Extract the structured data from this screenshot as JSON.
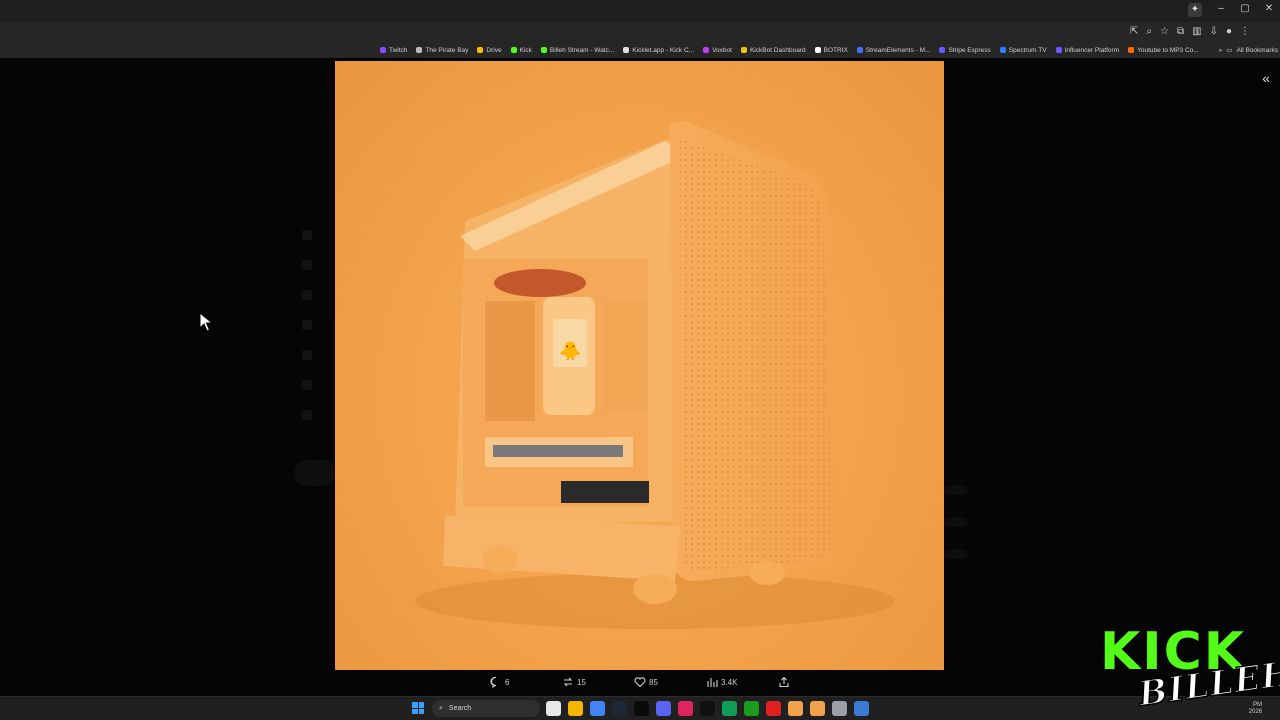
{
  "window": {
    "controls": [
      "–",
      "▢",
      "✕"
    ]
  },
  "bookmarks": [
    {
      "label": "Twitch",
      "color": "#9146ff"
    },
    {
      "label": "The Pirate Bay",
      "color": "#bbbbbb"
    },
    {
      "label": "Drive",
      "color": "#fbbc04"
    },
    {
      "label": "Kick",
      "color": "#53fc18"
    },
    {
      "label": "Billeh Stream - Watc...",
      "color": "#53fc18"
    },
    {
      "label": "Kicklet.app - Kick C...",
      "color": "#dddddd"
    },
    {
      "label": "Voxbot",
      "color": "#c13bff"
    },
    {
      "label": "KickBot Dashboard",
      "color": "#f4c20d"
    },
    {
      "label": "BOTRIX",
      "color": "#ffffff"
    },
    {
      "label": "StreamElements - M...",
      "color": "#4a6cf7"
    },
    {
      "label": "Stripe Express",
      "color": "#635bff"
    },
    {
      "label": "Spectrum TV",
      "color": "#2a7fff"
    },
    {
      "label": "Influencer Platform",
      "color": "#6b5bff"
    },
    {
      "label": "Youtube to MP3 Co...",
      "color": "#ff6a00"
    }
  ],
  "bookmarks_more": "»",
  "all_bookmarks": "All Bookmarks",
  "post": {
    "actions": {
      "replies": "6",
      "reposts": "15",
      "likes": "85",
      "views": "3.4K"
    }
  },
  "overlay": {
    "kick_word": "KICK",
    "kick_sub": "BILLEH",
    "clock_time": "PM",
    "clock_date": "2026"
  },
  "taskbar": {
    "search_placeholder": "Search",
    "apps": [
      "#e8e8e8",
      "#f4b400",
      "#4285f4",
      "#1b2838",
      "#0a0a0a",
      "#5865f2",
      "#e0245e",
      "#111111",
      "#0f9d58",
      "#1d9b1d",
      "#e02020",
      "#f2a24a",
      "#f2a24a",
      "#9aa0a6",
      "#3a7bd5"
    ]
  },
  "colors": {
    "media_bg": "#f2a24a",
    "case": "#f7b061",
    "accent_green": "#53fc18"
  }
}
